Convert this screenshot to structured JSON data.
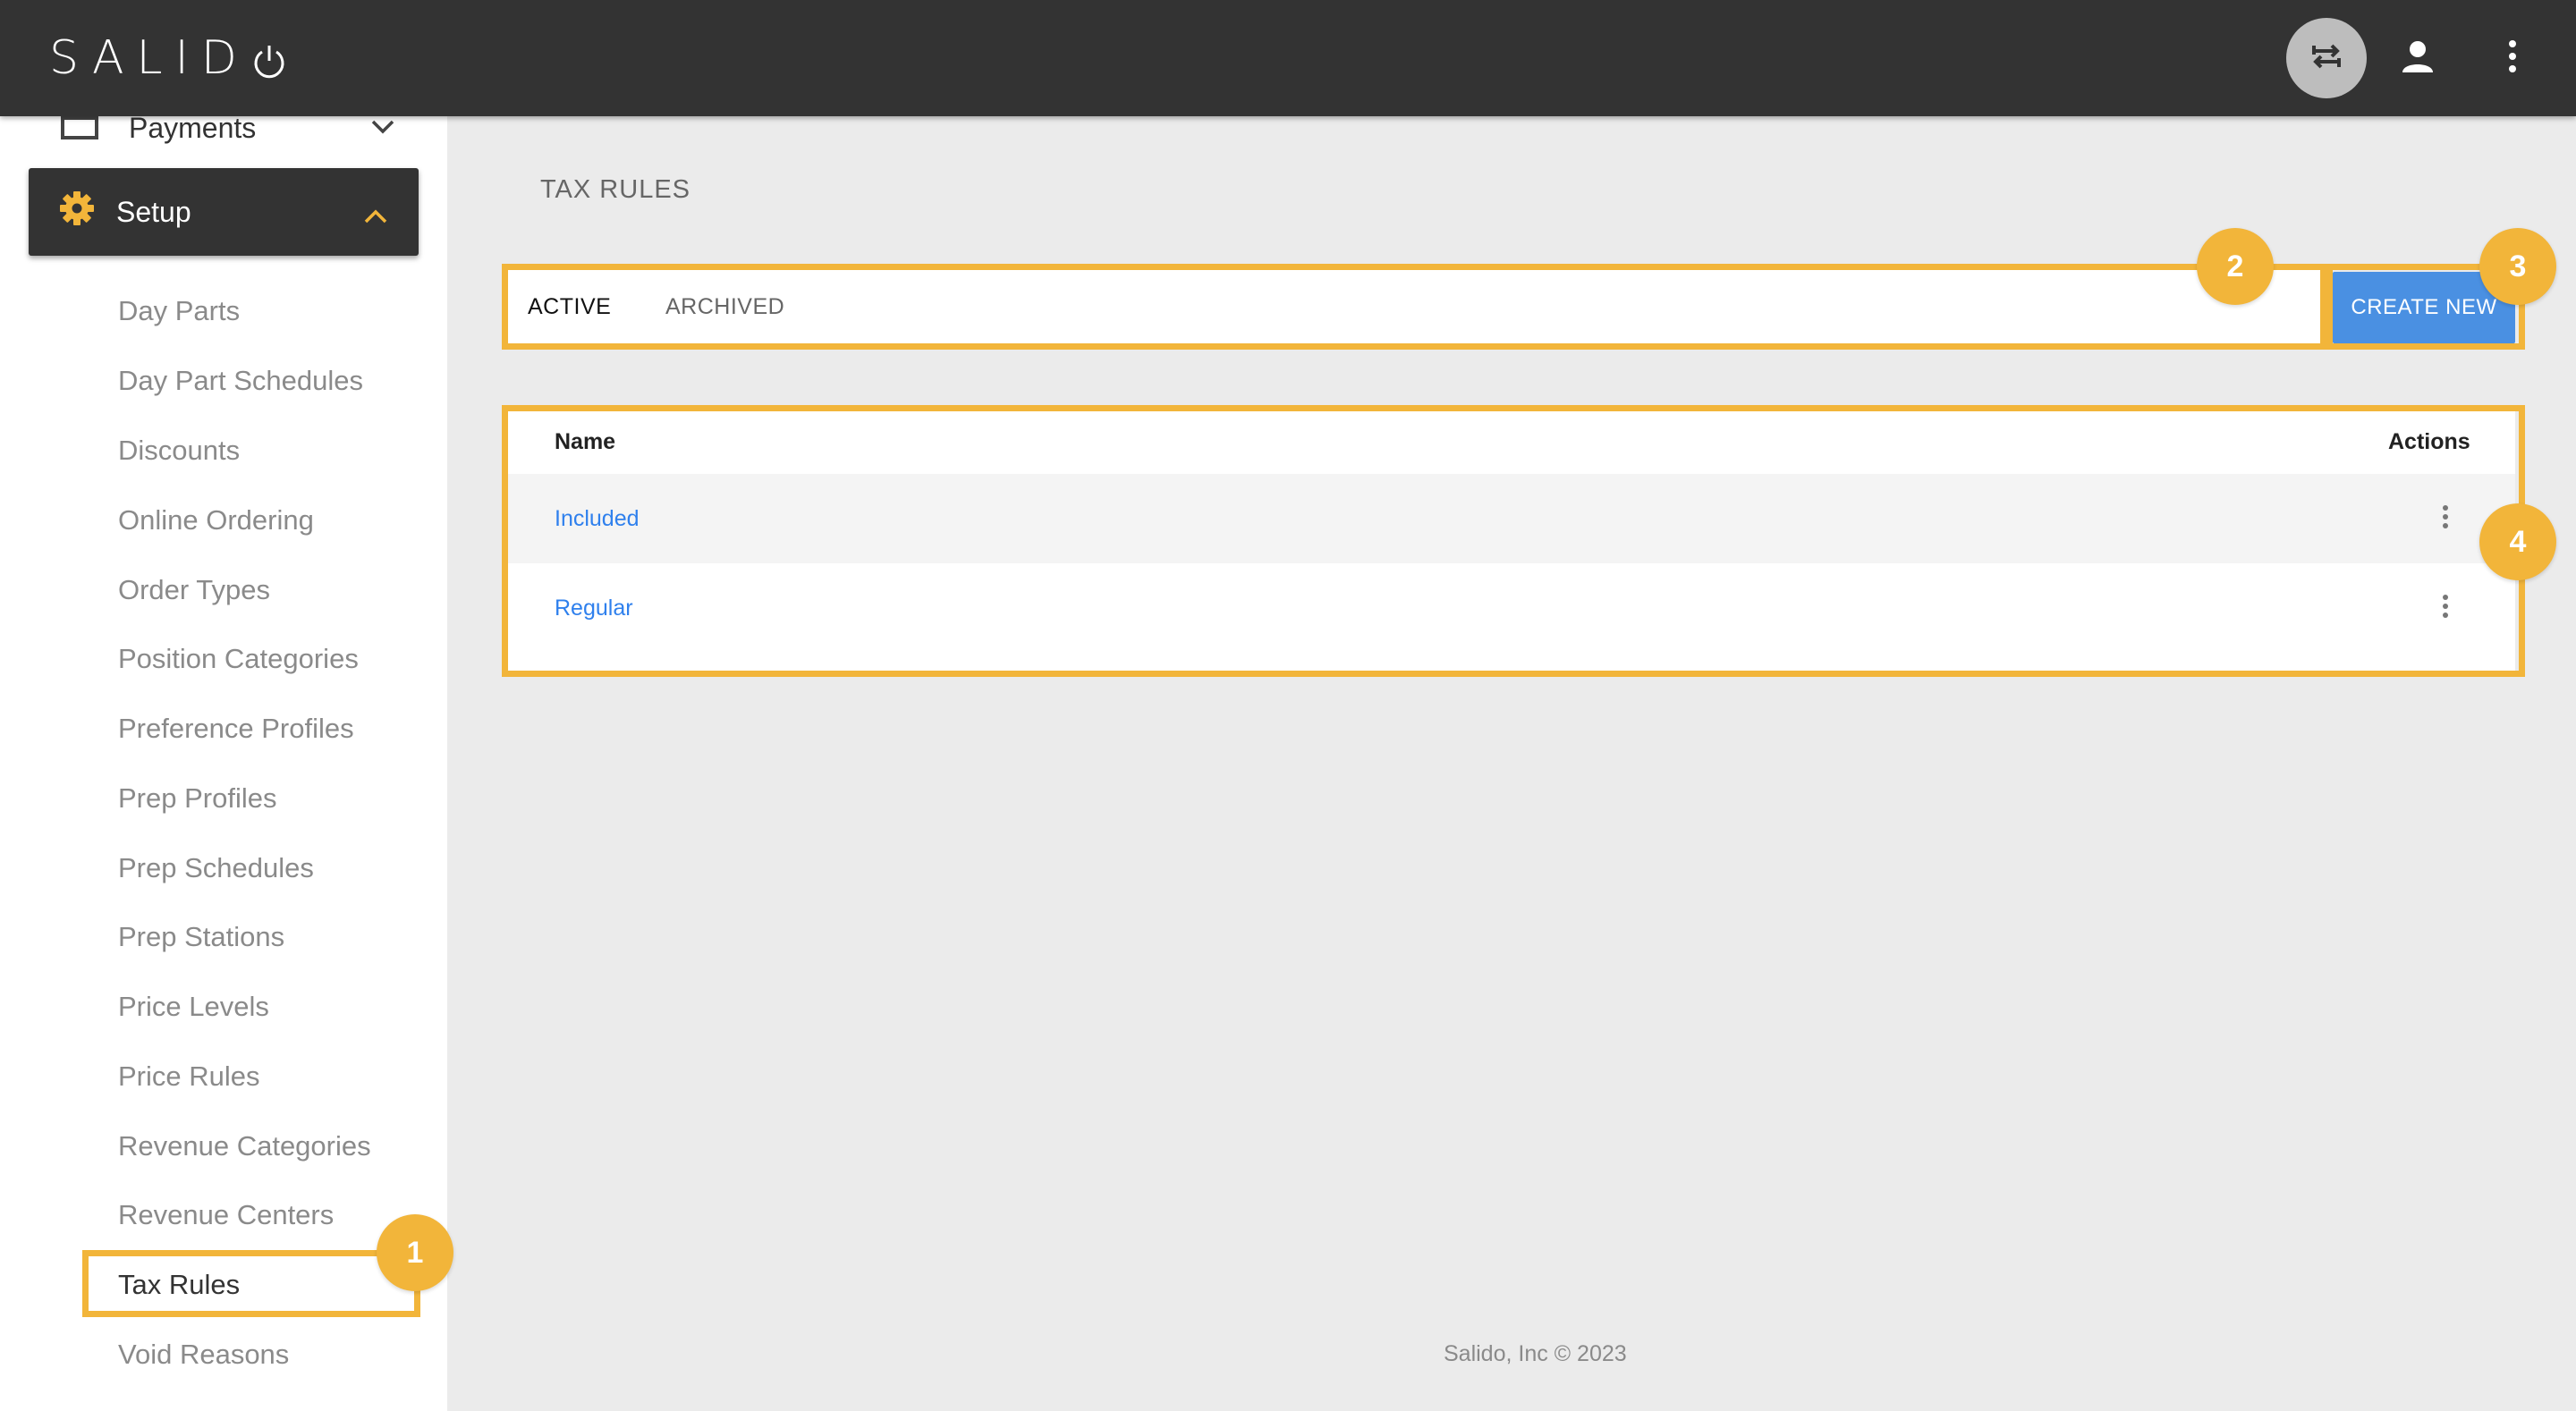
{
  "app": {
    "logo_text": "SALID",
    "icons": {
      "switch": "switch-arrows-icon",
      "user": "user-icon",
      "more": "more-vert-icon"
    }
  },
  "sidebar": {
    "payments_label": "Payments",
    "setup_label": "Setup",
    "items": [
      {
        "label": "Day Parts"
      },
      {
        "label": "Day Part Schedules"
      },
      {
        "label": "Discounts"
      },
      {
        "label": "Online Ordering"
      },
      {
        "label": "Order Types"
      },
      {
        "label": "Position Categories"
      },
      {
        "label": "Preference Profiles"
      },
      {
        "label": "Prep Profiles"
      },
      {
        "label": "Prep Schedules"
      },
      {
        "label": "Prep Stations"
      },
      {
        "label": "Price Levels"
      },
      {
        "label": "Price Rules"
      },
      {
        "label": "Revenue Categories"
      },
      {
        "label": "Revenue Centers"
      },
      {
        "label": "Tax Rules"
      },
      {
        "label": "Void Reasons"
      }
    ]
  },
  "main": {
    "title": "TAX RULES",
    "tabs": [
      {
        "label": "ACTIVE"
      },
      {
        "label": "ARCHIVED"
      }
    ],
    "create_label": "CREATE NEW",
    "table": {
      "headers": {
        "name": "Name",
        "actions": "Actions"
      },
      "rows": [
        {
          "name": "Included"
        },
        {
          "name": "Regular"
        }
      ]
    }
  },
  "annotations": [
    "1",
    "2",
    "3",
    "4"
  ],
  "footer": "Salido, Inc © 2023",
  "colors": {
    "accent": "#f2b53a",
    "topbar": "#333333",
    "button": "#4a90e2",
    "link": "#2f80ed"
  }
}
